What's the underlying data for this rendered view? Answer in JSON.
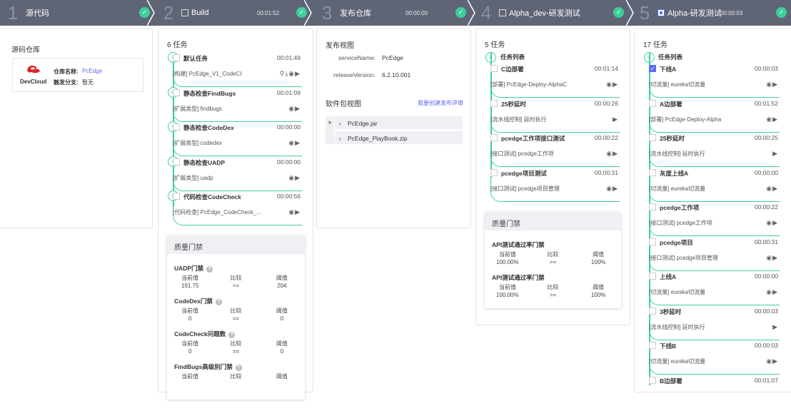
{
  "stages": [
    {
      "num": "1",
      "name": "源代码",
      "time": "",
      "status": "success"
    },
    {
      "num": "2",
      "name": "Build",
      "time": "00:01:52",
      "status": "success",
      "checkbox": false
    },
    {
      "num": "3",
      "name": "发布仓库",
      "time": "00:00:00",
      "status": "success"
    },
    {
      "num": "4",
      "name": "Alpha_dev-研发测试",
      "time": "",
      "status": "success",
      "checkbox": false
    },
    {
      "num": "5",
      "name": "Alpha-研发测试",
      "time": "00:00:03",
      "status": "success",
      "checkbox": true
    }
  ],
  "source": {
    "title": "源码仓库",
    "logo": "DevCloud",
    "repo_label": "仓库名称:",
    "repo_value": "PcEdge",
    "branch_label": "触发分支:",
    "branch_value": "暂无"
  },
  "build": {
    "count": "6 任务",
    "tasks": [
      {
        "title": "默认任务",
        "time": "00:01:49",
        "sub": "[构建] PcEdge_V1_CodeCI",
        "icons": [
          "pin",
          "download",
          "eye",
          "play"
        ]
      },
      {
        "title": "静态检查FindBugs",
        "time": "00:01:09",
        "sub": "[扩展类型] findbugs",
        "icons": [
          "eye",
          "play"
        ]
      },
      {
        "title": "静态检查CodeDex",
        "time": "00:00:00",
        "sub": "[扩展类型] codedex",
        "icons": [
          "eye",
          "play"
        ]
      },
      {
        "title": "静态检查UADP",
        "time": "00:00:00",
        "sub": "[扩展类型] uadp",
        "icons": [
          "eye",
          "play"
        ]
      },
      {
        "title": "代码检查CodeCheck",
        "time": "00:00:56",
        "sub": "[代码检查] PcEdge_CodeCheck_...",
        "icons": [
          "eye",
          "play"
        ]
      }
    ],
    "gate": {
      "title": "质量门禁",
      "items": [
        {
          "name": "UADP门禁",
          "cols": [
            "当前值",
            "比较",
            "阈值"
          ],
          "vals": [
            "191.75",
            "<=",
            "204"
          ]
        },
        {
          "name": "CodeDex门禁",
          "cols": [
            "当前值",
            "比较",
            "阈值"
          ],
          "vals": [
            "0",
            "==",
            "0"
          ]
        },
        {
          "name": "CodeCheck问题数",
          "cols": [
            "当前值",
            "比较",
            "阈值"
          ],
          "vals": [
            "0",
            "==",
            "0"
          ]
        },
        {
          "name": "FindBugs高级别门禁",
          "cols": [
            "当前值",
            "比较",
            "阈值"
          ],
          "vals": [
            "",
            "",
            ""
          ]
        }
      ]
    }
  },
  "release": {
    "title": "发布视图",
    "service_label": "serviceName:",
    "service_value": "PcEdge",
    "version_label": "releaseVersion:",
    "version_value": "6.2.10.001",
    "pkg_title": "软件包视图",
    "create_link": "我要创建发布评审",
    "packages": [
      "PcEdge.jar",
      "PcEdge_PlayBook.zip"
    ]
  },
  "alpha_dev": {
    "count": "5 任务",
    "group": "任务列表",
    "tasks": [
      {
        "title": "C边部署",
        "time": "00:01:14",
        "sub": "[部署] PcEdge-Deploy-AlphaC",
        "icons": [
          "eye",
          "play"
        ]
      },
      {
        "title": "25秒延时",
        "time": "00:00:26",
        "sub": "[流水线控制] 延时执行",
        "icons": [
          "play"
        ]
      },
      {
        "title": "pcedge工作项接口测试",
        "time": "00:00:22",
        "sub": "[接口测试] pcedge工作项",
        "icons": [
          "eye",
          "play"
        ]
      },
      {
        "title": "pcedge项目测试",
        "time": "00:00:31",
        "sub": "[接口测试] pcedge项目管理",
        "icons": [
          "eye",
          "play"
        ]
      }
    ],
    "gate": {
      "title": "质量门禁",
      "items": [
        {
          "name": "API测试通过率门禁",
          "cols": [
            "当前值",
            "比较",
            "阈值"
          ],
          "vals": [
            "100.00%",
            ">=",
            "100%"
          ]
        },
        {
          "name": "API测试通过率门禁",
          "cols": [
            "当前值",
            "比较",
            "阈值"
          ],
          "vals": [
            "100.00%",
            ">=",
            "100%"
          ]
        }
      ]
    }
  },
  "alpha": {
    "count": "17 任务",
    "group": "任务列表",
    "tasks": [
      {
        "title": "下线A",
        "time": "00:00:03",
        "sub": "[切流量] eureka切流量",
        "icons": [
          "eye",
          "play"
        ],
        "checked": true
      },
      {
        "title": "A边部署",
        "time": "00:01:52",
        "sub": "[部署] PcEdge-Deploy-Alpha",
        "icons": [
          "eye",
          "play"
        ]
      },
      {
        "title": "25秒延时",
        "time": "00:00:25",
        "sub": "[流水线控制] 延时执行",
        "icons": [
          "play"
        ]
      },
      {
        "title": "灰度上线A",
        "time": "00:00:00",
        "sub": "[切流量] eureka切流量",
        "icons": [
          "eye",
          "play"
        ]
      },
      {
        "title": "pcedge工作项",
        "time": "00:00:22",
        "sub": "[接口测试] pcedge工作项",
        "icons": [
          "eye",
          "play"
        ]
      },
      {
        "title": "pcedge项目",
        "time": "00:00:31",
        "sub": "[接口测试] pcedge项目管理",
        "icons": [
          "eye",
          "play"
        ]
      },
      {
        "title": "上线A",
        "time": "00:00:00",
        "sub": "[切流量] eureka切流量",
        "icons": [
          "eye",
          "play"
        ]
      },
      {
        "title": "3秒延时",
        "time": "00:00:03",
        "sub": "[流水线控制] 延时执行",
        "icons": [
          "play"
        ]
      },
      {
        "title": "下线B",
        "time": "00:00:03",
        "sub": "[切流量] eureka切流量",
        "icons": [
          "eye",
          "play"
        ]
      },
      {
        "title": "B边部署",
        "time": "00:01:07",
        "sub": "",
        "icons": []
      }
    ]
  },
  "colors": {
    "header": "#5f6575",
    "success": "#3ecf9a",
    "accent": "#5a6ef0"
  }
}
